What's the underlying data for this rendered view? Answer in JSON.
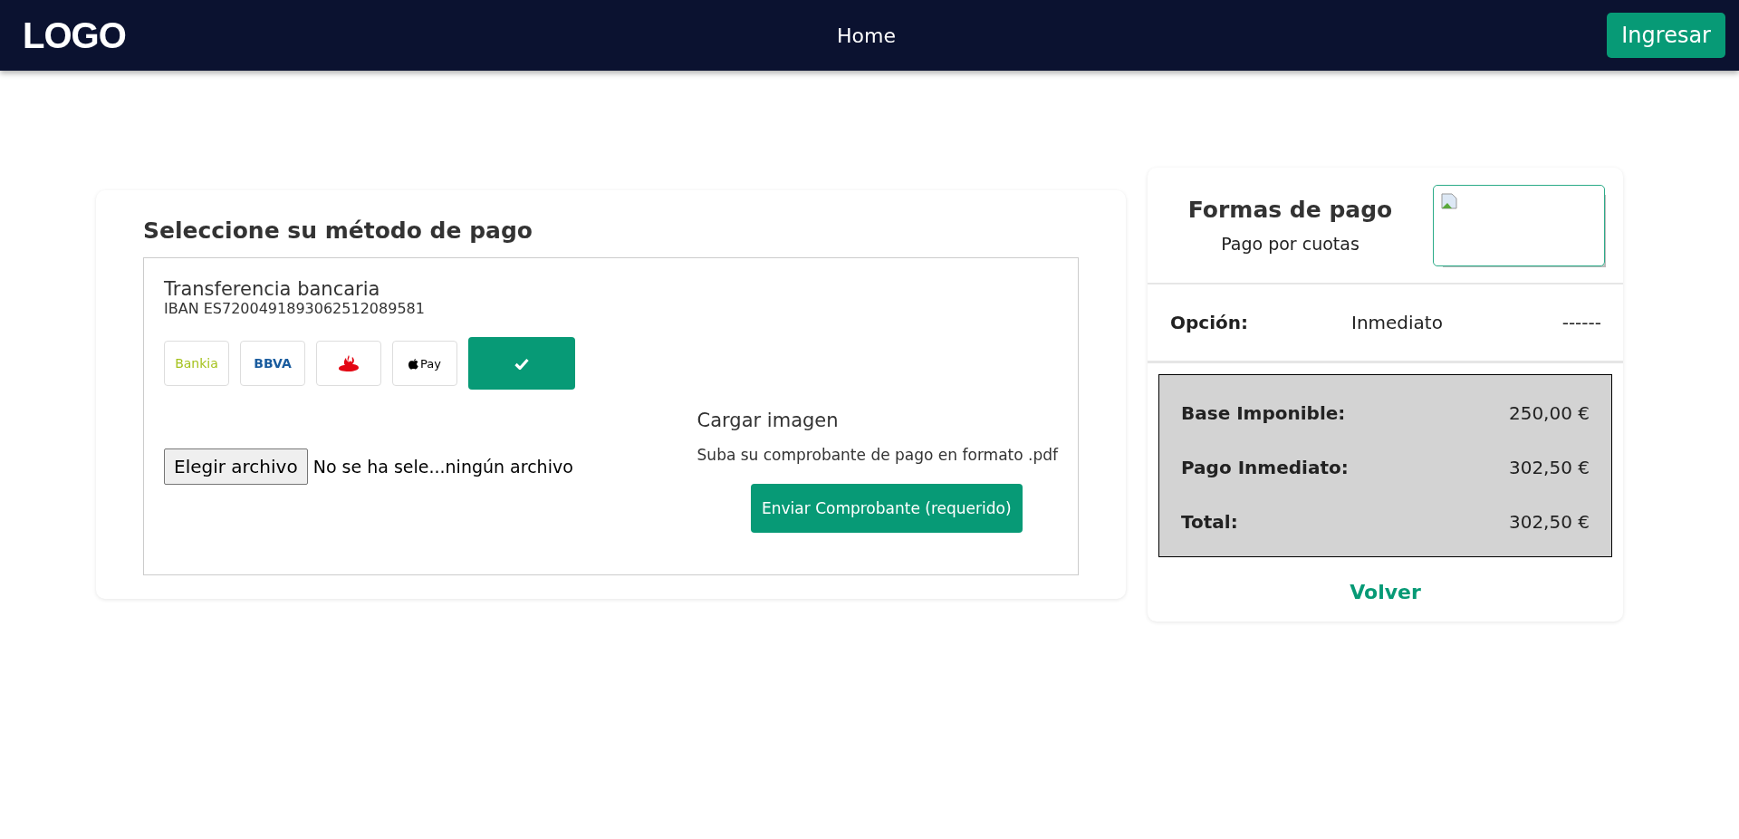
{
  "navbar": {
    "logo": "LOGO",
    "links": [
      {
        "label": "Home"
      }
    ],
    "login_button": "Ingresar"
  },
  "payment_card": {
    "title": "Seleccione su método de pago",
    "method": {
      "name": "Transferencia bancaria",
      "iban": "IBAN ES7200491893062512089581"
    },
    "options": [
      {
        "kind": "bankia",
        "label": "Bankia"
      },
      {
        "kind": "bbva",
        "label": "BBVA"
      },
      {
        "kind": "santander"
      },
      {
        "kind": "applepay",
        "label": "Pay"
      }
    ],
    "file_input": {
      "button": "Elegir archivo",
      "status": "No se ha sele...ningún archivo"
    },
    "upload": {
      "title": "Cargar imagen",
      "hint": "Suba su comprobante de pago en formato .pdf",
      "button": "Enviar Comprobante (requerido)"
    }
  },
  "summary_card": {
    "title": "Formas de pago",
    "subtitle": "Pago por cuotas",
    "option": {
      "label": "Opción:",
      "value": "Inmediato",
      "extra": "------"
    },
    "totals": [
      {
        "label": "Base Imponible:",
        "value": "250,00 €"
      },
      {
        "label": "Pago Inmediato:",
        "value": "302,50 €"
      },
      {
        "label": "Total:",
        "value": "302,50 €"
      }
    ],
    "back_link": "Volver"
  }
}
